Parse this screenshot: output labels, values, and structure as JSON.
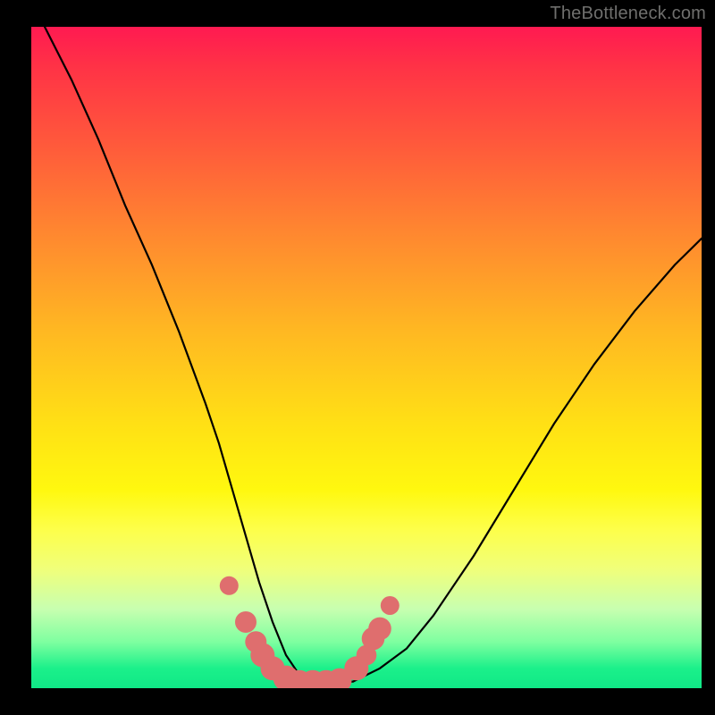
{
  "watermark": "TheBottleneck.com",
  "colors": {
    "curve_stroke": "#000000",
    "marker_fill": "#df6e6e",
    "marker_stroke": "#df6e6e"
  },
  "chart_data": {
    "type": "line",
    "title": "",
    "xlabel": "",
    "ylabel": "",
    "xlim": [
      0,
      100
    ],
    "ylim": [
      0,
      100
    ],
    "grid": false,
    "note": "No axes/ticks/labels visible in the image; values below are estimated from geometry of the curve within the plot rectangle (x=0..100 left→right, y=0..100 bottom→top).",
    "series": [
      {
        "name": "bottleneck-curve",
        "x": [
          2,
          6,
          10,
          14,
          18,
          22,
          26,
          28,
          30,
          32,
          34,
          36,
          38,
          40,
          42,
          44,
          48,
          52,
          56,
          60,
          66,
          72,
          78,
          84,
          90,
          96,
          100
        ],
        "y": [
          100,
          92,
          83,
          73,
          64,
          54,
          43,
          37,
          30,
          23,
          16,
          10,
          5,
          2,
          1,
          1,
          1,
          3,
          6,
          11,
          20,
          30,
          40,
          49,
          57,
          64,
          68
        ]
      }
    ],
    "markers": {
      "name": "highlight-points",
      "note": "Pink dots near the trough, sizes vary.",
      "points": [
        {
          "x": 29.5,
          "y": 15.5,
          "r": 1.2
        },
        {
          "x": 32.0,
          "y": 10.0,
          "r": 1.6
        },
        {
          "x": 33.5,
          "y": 7.0,
          "r": 1.6
        },
        {
          "x": 34.5,
          "y": 5.0,
          "r": 2.0
        },
        {
          "x": 36.0,
          "y": 3.0,
          "r": 2.0
        },
        {
          "x": 38.0,
          "y": 1.5,
          "r": 2.2
        },
        {
          "x": 40.0,
          "y": 0.8,
          "r": 2.2
        },
        {
          "x": 42.0,
          "y": 0.8,
          "r": 2.2
        },
        {
          "x": 44.0,
          "y": 0.8,
          "r": 2.2
        },
        {
          "x": 46.0,
          "y": 1.2,
          "r": 2.0
        },
        {
          "x": 48.5,
          "y": 3.0,
          "r": 2.0
        },
        {
          "x": 50.0,
          "y": 5.0,
          "r": 1.4
        },
        {
          "x": 51.0,
          "y": 7.5,
          "r": 1.8
        },
        {
          "x": 52.0,
          "y": 9.0,
          "r": 1.8
        },
        {
          "x": 53.5,
          "y": 12.5,
          "r": 1.2
        }
      ]
    }
  }
}
